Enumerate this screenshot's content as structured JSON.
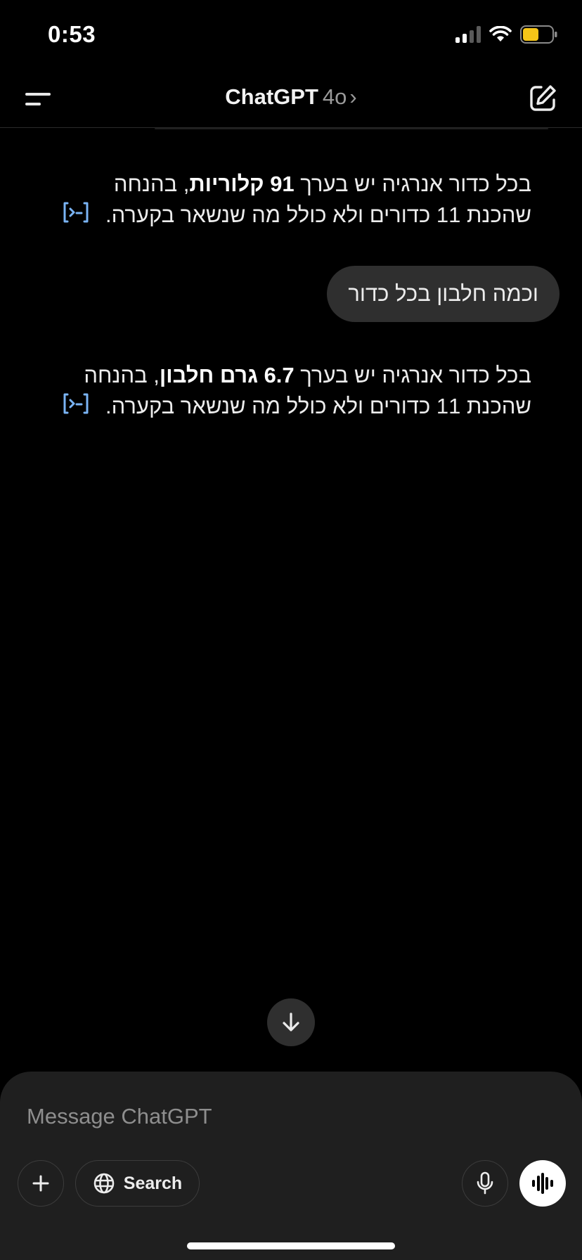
{
  "status_bar": {
    "time": "0:53"
  },
  "nav": {
    "title": "ChatGPT",
    "model": "4o",
    "chevron": "›"
  },
  "messages": [
    {
      "role": "assistant",
      "before_bold": "בכל כדור אנרגיה יש בערך ",
      "bold": "91 קלוריות",
      "after_bold": ", בהנחה שהכנת 11 כדורים ולא כולל מה שנשאר בקערה."
    },
    {
      "role": "user",
      "text": "וכמה חלבון בכל כדור"
    },
    {
      "role": "assistant",
      "before_bold": "בכל כדור אנרגיה יש בערך ",
      "bold": "6.7 גרם חלבון",
      "after_bold": ", בהנחה שהכנת 11 כדורים ולא כולל מה שנשאר בקערה."
    }
  ],
  "composer": {
    "placeholder": "Message ChatGPT",
    "search_label": "Search"
  },
  "colors": {
    "background": "#000000",
    "bubble": "#2f2f2f",
    "composer": "#1f1f1f",
    "accent_icon": "#7ab4f5"
  },
  "icons": {
    "menu": "menu-icon",
    "new_chat": "edit-icon",
    "ai_response": "ai-badge-icon",
    "scroll": "arrow-down-icon",
    "plus": "plus-icon",
    "globe": "globe-icon",
    "mic": "mic-icon",
    "voice": "voice-waveform-icon"
  }
}
